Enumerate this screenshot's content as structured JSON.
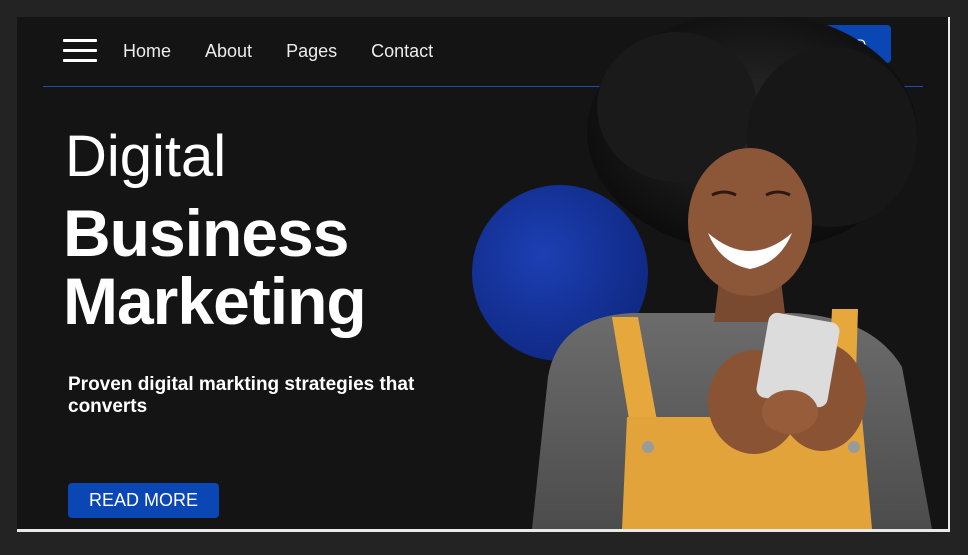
{
  "nav": {
    "items": [
      "Home",
      "About",
      "Pages",
      "Contact"
    ],
    "cta_label": "GET STARTED"
  },
  "hero": {
    "line1": "Digital",
    "line2": "Business",
    "line3": "Marketing",
    "subtitle": "Proven digital markting strategies that converts",
    "button_label": "READ MORE"
  },
  "colors": {
    "accent": "#0a46b4",
    "background": "#141414",
    "text": "#ffffff"
  }
}
